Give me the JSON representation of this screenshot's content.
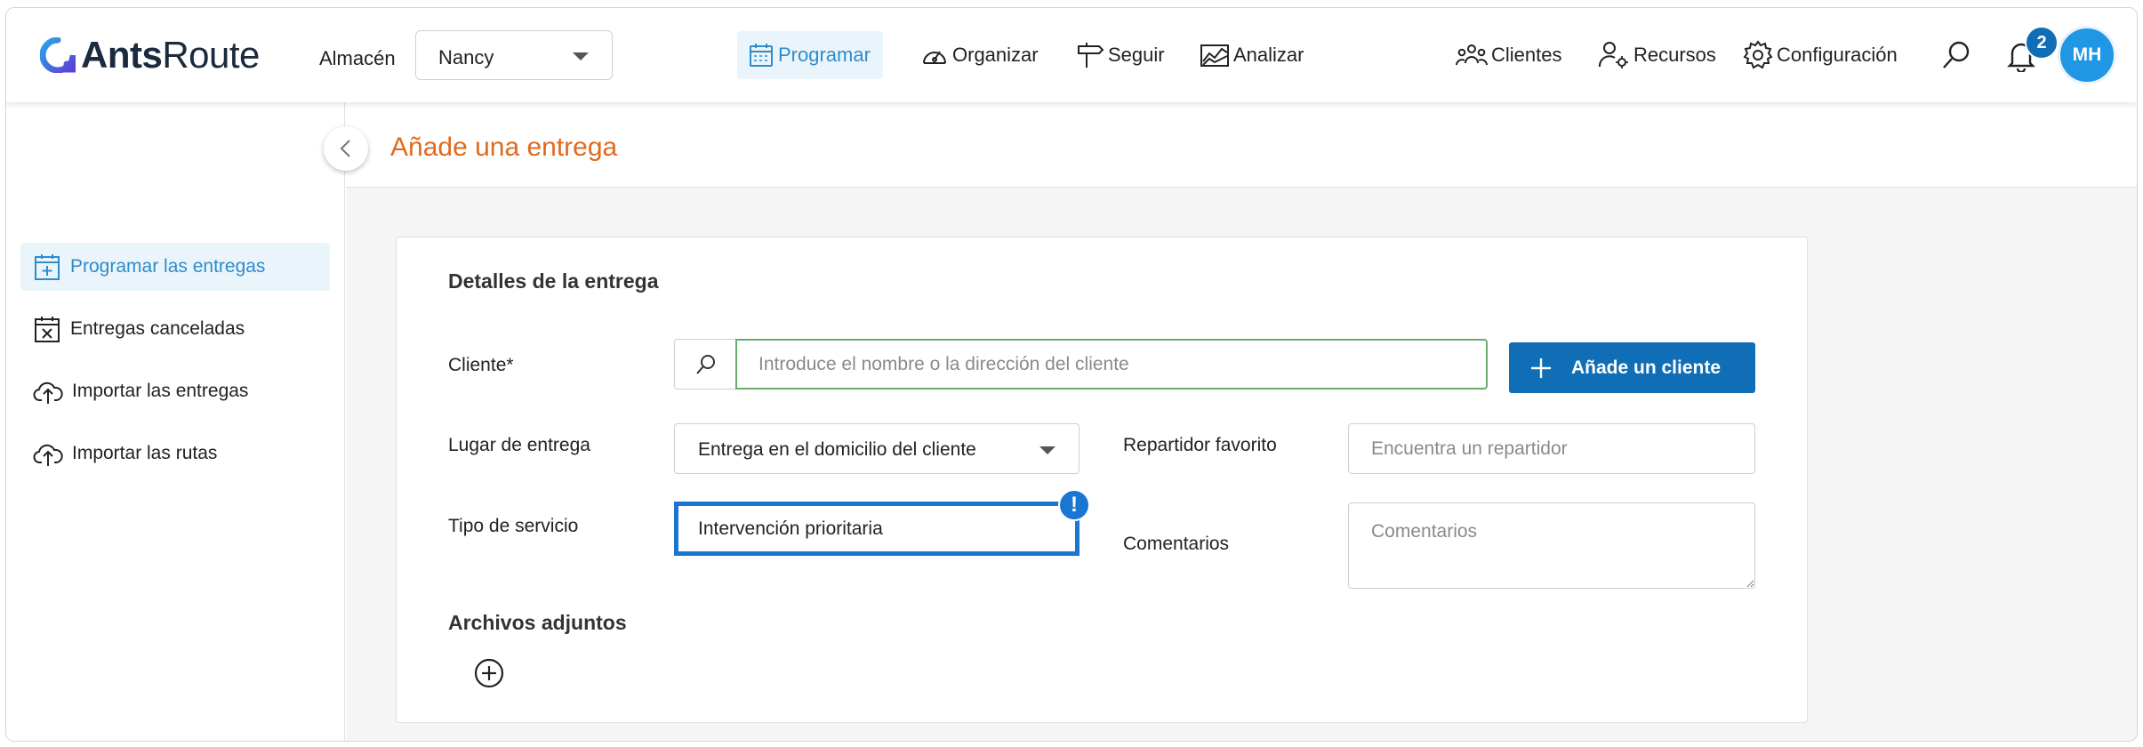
{
  "app": {
    "brand_bold": "Ants",
    "brand_light": "Route"
  },
  "header": {
    "warehouse_label": "Almacén",
    "warehouse_value": "Nancy",
    "nav": {
      "programar": "Programar",
      "organizar": "Organizar",
      "seguir": "Seguir",
      "analizar": "Analizar",
      "clientes": "Clientes",
      "recursos": "Recursos",
      "configuracion": "Configuración"
    },
    "notifications_count": "2",
    "user_initials": "MH"
  },
  "sidebar": {
    "items": [
      {
        "label": "Programar las entregas",
        "icon": "calendar-plus-icon",
        "active": true
      },
      {
        "label": "Entregas canceladas",
        "icon": "calendar-x-icon",
        "active": false
      },
      {
        "label": "Importar las entregas",
        "icon": "cloud-upload-icon",
        "active": false
      },
      {
        "label": "Importar las rutas",
        "icon": "cloud-upload-icon",
        "active": false
      }
    ]
  },
  "page": {
    "title": "Añade una entrega"
  },
  "form": {
    "section_title": "Detalles de la entrega",
    "client_label": "Cliente*",
    "client_placeholder": "Introduce el nombre o la dirección del cliente",
    "add_client_label": "Añade un cliente",
    "delivery_place_label": "Lugar de entrega",
    "delivery_place_value": "Entrega en el domicilio del cliente",
    "favorite_driver_label": "Repartidor favorito",
    "favorite_driver_placeholder": "Encuentra un repartidor",
    "service_type_label": "Tipo de servicio",
    "service_type_value": "Intervención prioritaria",
    "warning_glyph": "!",
    "comments_label": "Comentarios",
    "comments_placeholder": "Comentarios",
    "attachments_title": "Archivos adjuntos"
  },
  "colors": {
    "accent_blue": "#0f6eb5",
    "active_blue": "#2f8ccc",
    "title_orange": "#e06a1d",
    "focus_blue": "#1a76d2",
    "input_green": "#6aaa6a"
  }
}
